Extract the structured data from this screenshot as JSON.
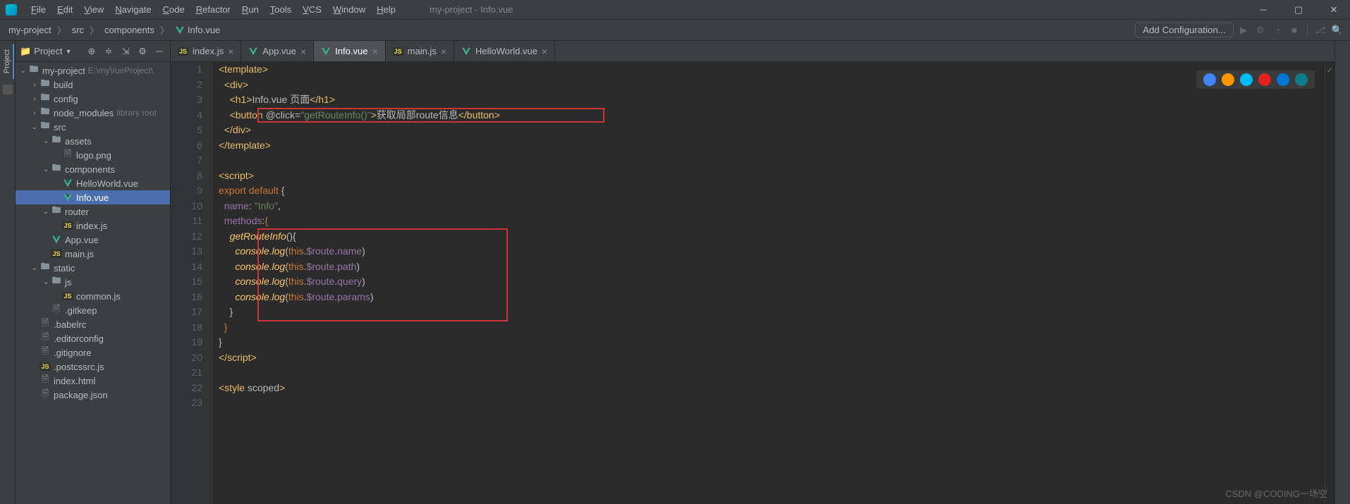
{
  "window": {
    "title": "my-project - Info.vue",
    "menus": [
      "File",
      "Edit",
      "View",
      "Navigate",
      "Code",
      "Refactor",
      "Run",
      "Tools",
      "VCS",
      "Window",
      "Help"
    ]
  },
  "breadcrumb": [
    "my-project",
    "src",
    "components",
    "Info.vue"
  ],
  "toolbar": {
    "add_config": "Add Configuration..."
  },
  "panel": {
    "title": "Project",
    "tree": [
      {
        "depth": 0,
        "arrow": "v",
        "icon": "folder",
        "label": "my-project",
        "extra": "E:\\myVueProject\\"
      },
      {
        "depth": 1,
        "arrow": ">",
        "icon": "folder",
        "label": "build"
      },
      {
        "depth": 1,
        "arrow": ">",
        "icon": "folder",
        "label": "config"
      },
      {
        "depth": 1,
        "arrow": ">",
        "icon": "folder",
        "label": "node_modules",
        "extra": "library root"
      },
      {
        "depth": 1,
        "arrow": "v",
        "icon": "folder",
        "label": "src"
      },
      {
        "depth": 2,
        "arrow": "v",
        "icon": "folder",
        "label": "assets"
      },
      {
        "depth": 3,
        "arrow": "",
        "icon": "file",
        "label": "logo.png"
      },
      {
        "depth": 2,
        "arrow": "v",
        "icon": "folder",
        "label": "components"
      },
      {
        "depth": 3,
        "arrow": "",
        "icon": "vue",
        "label": "HelloWorld.vue"
      },
      {
        "depth": 3,
        "arrow": "",
        "icon": "vue",
        "label": "Info.vue",
        "selected": true
      },
      {
        "depth": 2,
        "arrow": "v",
        "icon": "folder",
        "label": "router"
      },
      {
        "depth": 3,
        "arrow": "",
        "icon": "js",
        "label": "index.js"
      },
      {
        "depth": 2,
        "arrow": "",
        "icon": "vue",
        "label": "App.vue"
      },
      {
        "depth": 2,
        "arrow": "",
        "icon": "js",
        "label": "main.js"
      },
      {
        "depth": 1,
        "arrow": "v",
        "icon": "folder",
        "label": "static"
      },
      {
        "depth": 2,
        "arrow": "v",
        "icon": "folder",
        "label": "js"
      },
      {
        "depth": 3,
        "arrow": "",
        "icon": "js",
        "label": "common.js"
      },
      {
        "depth": 2,
        "arrow": "",
        "icon": "file",
        "label": ".gitkeep"
      },
      {
        "depth": 1,
        "arrow": "",
        "icon": "file",
        "label": ".babelrc"
      },
      {
        "depth": 1,
        "arrow": "",
        "icon": "file",
        "label": ".editorconfig"
      },
      {
        "depth": 1,
        "arrow": "",
        "icon": "file",
        "label": ".gitignore"
      },
      {
        "depth": 1,
        "arrow": "",
        "icon": "js",
        "label": ".postcssrc.js"
      },
      {
        "depth": 1,
        "arrow": "",
        "icon": "file",
        "label": "index.html"
      },
      {
        "depth": 1,
        "arrow": "",
        "icon": "file",
        "label": "package.json"
      }
    ]
  },
  "tabs": [
    {
      "icon": "js",
      "label": "index.js"
    },
    {
      "icon": "vue",
      "label": "App.vue"
    },
    {
      "icon": "vue",
      "label": "Info.vue",
      "active": true
    },
    {
      "icon": "js",
      "label": "main.js"
    },
    {
      "icon": "vue",
      "label": "HelloWorld.vue"
    }
  ],
  "code": {
    "lines": 23,
    "content": [
      {
        "n": 1,
        "html": "<span class='tag'>&lt;template&gt;</span>"
      },
      {
        "n": 2,
        "html": "  <span class='tag'>&lt;div&gt;</span>"
      },
      {
        "n": 3,
        "html": "    <span class='tag'>&lt;h1&gt;</span><span class='text-content'>Info.vue 页面</span><span class='tag'>&lt;/h1&gt;</span>"
      },
      {
        "n": 4,
        "html": "    <span class='tag'>&lt;button </span><span class='attr'>@click=</span><span class='string'>\"getRouteInfo()\"</span><span class='tag'>&gt;</span><span class='text-content'>获取局部route信息</span><span class='tag'>&lt;/button&gt;</span>"
      },
      {
        "n": 5,
        "html": "  <span class='tag'>&lt;/div&gt;</span>"
      },
      {
        "n": 6,
        "html": "<span class='tag'>&lt;/template&gt;</span>"
      },
      {
        "n": 7,
        "html": ""
      },
      {
        "n": 8,
        "html": "<span class='tag'>&lt;script&gt;</span>"
      },
      {
        "n": 9,
        "html": "<span class='keyword'>export default </span>{"
      },
      {
        "n": 10,
        "html": "  <span class='prop'>name</span>: <span class='string'>\"Info\"</span>,"
      },
      {
        "n": 11,
        "html": "  <span class='prop'>methods</span>:<span class='brace'>{</span>"
      },
      {
        "n": 12,
        "html": "    <span class='method-italic'>getRouteInfo</span>(){"
      },
      {
        "n": 13,
        "html": "      <span class='method-italic'>console</span>.<span class='method-italic'>log</span>(<span class='keyword'>this</span>.<span class='prop'>$route</span>.<span class='prop'>name</span>)"
      },
      {
        "n": 14,
        "html": "      <span class='method-italic'>console</span>.<span class='method-italic'>log</span>(<span class='keyword'>this</span>.<span class='prop'>$route</span>.<span class='prop'>path</span>)"
      },
      {
        "n": 15,
        "html": "      <span class='method-italic'>console</span>.<span class='method-italic'>log</span>(<span class='keyword'>this</span>.<span class='prop'>$route</span>.<span class='prop'>query</span>)"
      },
      {
        "n": 16,
        "html": "      <span class='method-italic'>console</span>.<span class='method-italic'>log</span>(<span class='keyword'>this</span>.<span class='prop'>$route</span>.<span class='prop'>params</span>)"
      },
      {
        "n": 17,
        "html": "    }"
      },
      {
        "n": 18,
        "html": "  <span class='brace'>}</span>"
      },
      {
        "n": 19,
        "html": "}"
      },
      {
        "n": 20,
        "html": "<span class='tag'>&lt;/script&gt;</span>"
      },
      {
        "n": 21,
        "html": ""
      },
      {
        "n": 22,
        "html": "<span class='tag'>&lt;style </span><span class='attr'>scoped</span><span class='tag'>&gt;</span>"
      },
      {
        "n": 23,
        "html": ""
      }
    ]
  },
  "browsers": [
    "#4285f4",
    "#ff9500",
    "#00bcf2",
    "#e2231a",
    "#0078d4",
    "#0f7c8c"
  ],
  "watermark": "CSDN @CODING一场空"
}
